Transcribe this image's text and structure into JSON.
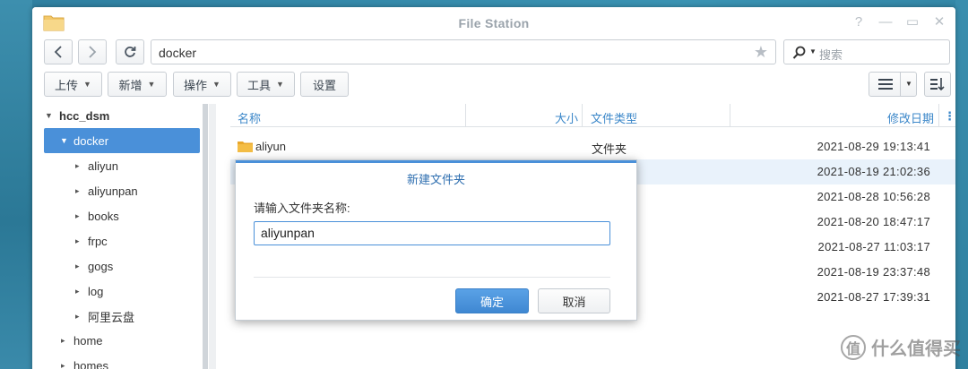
{
  "window": {
    "title": "File Station",
    "controls": [
      "?",
      "—",
      "▭",
      "✕"
    ]
  },
  "nav": {
    "path": "docker",
    "search_placeholder": "搜索"
  },
  "toolbar": {
    "upload": "上传",
    "create": "新增",
    "action": "操作",
    "tools": "工具",
    "settings": "设置"
  },
  "tree": {
    "root": "hcc_dsm",
    "selected": "docker",
    "children": [
      "aliyun",
      "aliyunpan",
      "books",
      "frpc",
      "gogs",
      "log",
      "阿里云盘"
    ],
    "siblings": [
      "home",
      "homes"
    ]
  },
  "columns": {
    "name": "名称",
    "size": "大小",
    "type": "文件类型",
    "modified": "修改日期"
  },
  "files": [
    {
      "name": "aliyun",
      "type": "文件夹",
      "modified": "2021-08-29 19:13:41"
    },
    {
      "name": "",
      "type": "",
      "modified": "2021-08-19 21:02:36"
    },
    {
      "name": "",
      "type": "",
      "modified": "2021-08-28 10:56:28"
    },
    {
      "name": "",
      "type": "",
      "modified": "2021-08-20 18:47:17"
    },
    {
      "name": "",
      "type": "",
      "modified": "2021-08-27 11:03:17"
    },
    {
      "name": "",
      "type": "",
      "modified": "2021-08-19 23:37:48"
    },
    {
      "name": "",
      "type": "",
      "modified": "2021-08-27 17:39:31"
    }
  ],
  "dialog": {
    "title": "新建文件夹",
    "label": "请输入文件夹名称:",
    "value": "aliyunpan",
    "ok": "确定",
    "cancel": "取消"
  },
  "watermark": "什么值得买",
  "colors": {
    "accent": "#4a90d9",
    "header_text": "#3b87c9",
    "folder": "#f0b93a"
  }
}
